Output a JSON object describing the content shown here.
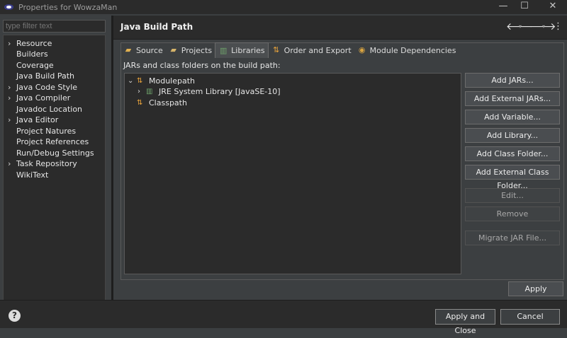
{
  "window": {
    "title": "Properties for WowzaMan",
    "controls": {
      "minimize": "—",
      "maximize": "☐",
      "close": "✕"
    }
  },
  "sidebar": {
    "filter_placeholder": "type filter text",
    "items": [
      {
        "label": "Resource",
        "expandable": true
      },
      {
        "label": "Builders",
        "expandable": false
      },
      {
        "label": "Coverage",
        "expandable": false
      },
      {
        "label": "Java Build Path",
        "expandable": false
      },
      {
        "label": "Java Code Style",
        "expandable": true
      },
      {
        "label": "Java Compiler",
        "expandable": true
      },
      {
        "label": "Javadoc Location",
        "expandable": false
      },
      {
        "label": "Java Editor",
        "expandable": true
      },
      {
        "label": "Project Natures",
        "expandable": false
      },
      {
        "label": "Project References",
        "expandable": false
      },
      {
        "label": "Run/Debug Settings",
        "expandable": false
      },
      {
        "label": "Task Repository",
        "expandable": true
      },
      {
        "label": "WikiText",
        "expandable": false
      }
    ]
  },
  "header": {
    "title": "Java Build Path",
    "back_icon": "arrow-left-icon",
    "forward_icon": "arrow-right-icon",
    "menu_icon": "more-vertical-icon"
  },
  "tabs": [
    {
      "label": "Source",
      "icon": "source-folder-icon"
    },
    {
      "label": "Projects",
      "icon": "projects-icon"
    },
    {
      "label": "Libraries",
      "icon": "libraries-icon",
      "active": true
    },
    {
      "label": "Order and Export",
      "icon": "order-export-icon"
    },
    {
      "label": "Module Dependencies",
      "icon": "module-icon"
    }
  ],
  "libraries": {
    "description": "JARs and class folders on the build path:",
    "tree": [
      {
        "label": "Modulepath",
        "level": 0,
        "expanded": true
      },
      {
        "label": "JRE System Library [JavaSE-10]",
        "level": 1,
        "expanded": false
      },
      {
        "label": "Classpath",
        "level": 0,
        "expanded": false
      }
    ],
    "buttons": [
      {
        "label": "Add JARs...",
        "enabled": true
      },
      {
        "label": "Add External JARs...",
        "enabled": true
      },
      {
        "label": "Add Variable...",
        "enabled": true
      },
      {
        "label": "Add Library...",
        "enabled": true
      },
      {
        "label": "Add Class Folder...",
        "enabled": true
      },
      {
        "label": "Add External Class Folder...",
        "enabled": true
      },
      {
        "label": "Edit...",
        "enabled": false
      },
      {
        "label": "Remove",
        "enabled": false
      },
      {
        "label": "Migrate JAR File...",
        "enabled": false
      }
    ],
    "apply_label": "Apply"
  },
  "footer": {
    "help_icon": "?",
    "apply_close_label": "Apply and Close",
    "cancel_label": "Cancel"
  },
  "colors": {
    "background": "#3c3f41",
    "panel": "#2b2b2b",
    "text": "#e6e6e6",
    "jar_icon_orange": "#e8a33c"
  }
}
